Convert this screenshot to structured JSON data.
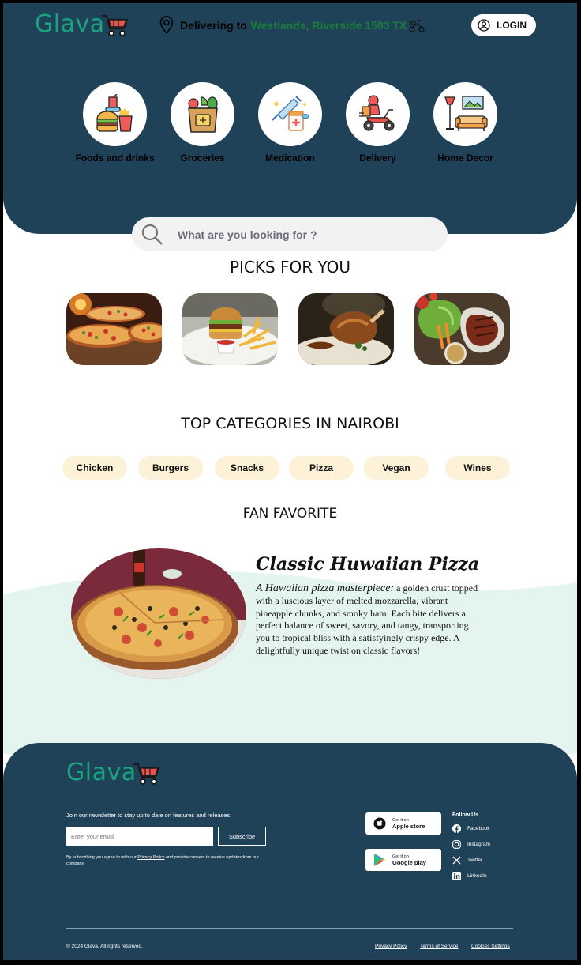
{
  "brand": {
    "name": "Glava",
    "color": "#1aa37f",
    "primary_bg": "#1f4258"
  },
  "header": {
    "delivering_label": "Delivering to",
    "address": "Westlands, Riverside 1583 TX",
    "login_label": "LOGIN"
  },
  "categories": [
    {
      "label": "Foods and drinks",
      "icon": "burger-fries-icon"
    },
    {
      "label": "Groceries",
      "icon": "grocery-bag-icon"
    },
    {
      "label": "Medication",
      "icon": "medication-icon"
    },
    {
      "label": "Delivery",
      "icon": "delivery-scooter-icon"
    },
    {
      "label": "Home Decor",
      "icon": "home-decor-icon"
    }
  ],
  "search": {
    "placeholder": "What are you looking for ?"
  },
  "picks": {
    "title": "PICKS FOR YOU",
    "items": [
      "pizza-photo",
      "burger-fries-photo",
      "roast-meat-photo",
      "steak-vegetables-photo"
    ]
  },
  "top_categories": {
    "title": "TOP CATEGORIES IN NAIROBI",
    "chips": [
      "Chicken",
      "Burgers",
      "Snacks",
      "Pizza",
      "Vegan",
      "Wines"
    ]
  },
  "fan_favorite": {
    "title": "FAN FAVORITE",
    "dish_name": "Classic Huwaiian Pizza",
    "lead": "A Hawaiian pizza masterpiece:",
    "description": " a golden crust topped with a luscious layer of melted mozzarella, vibrant pineapple chunks, and smoky ham. Each bite delivers a perfect balance of sweet, savory, and tangy, transporting you to tropical bliss with a satisfyingly crispy edge. A delightfully unique twist on classic flavors!"
  },
  "footer": {
    "newsletter_text": "Join our newsletter to stay up to date on features and releases.",
    "email_placeholder": "Enter your email",
    "subscribe_label": "Subscribe",
    "consent_prefix": "By subscribing you agree to with our ",
    "consent_link": "Privacy Policy",
    "consent_suffix": " and provide consent to receive updates from our company.",
    "apple": {
      "small": "Get it on",
      "big": "Apple store"
    },
    "google": {
      "small": "Get it on",
      "big": "Google play"
    },
    "follow_title": "Follow Us",
    "social": [
      "Facebook",
      "Instagram",
      "Twitter",
      "LinkedIn"
    ],
    "copyright": "© 2024 Glava. All rights reserved.",
    "links": [
      "Privacy Policy",
      "Terms of Service",
      "Cookies Settings"
    ]
  }
}
